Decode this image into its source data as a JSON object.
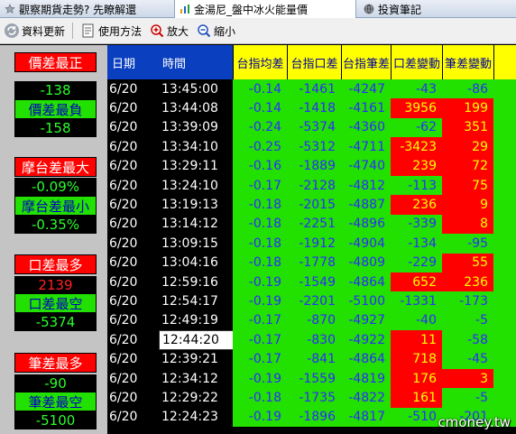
{
  "tabs": [
    {
      "icon": "star-icon",
      "label": "觀察期貨走勢? 先瞭解還"
    },
    {
      "icon": "chart-icon",
      "label": "金湯尼_盤中冰火能量價"
    },
    {
      "icon": "globe-icon",
      "label": "投資筆記"
    }
  ],
  "toolbar": {
    "refresh_label": "資料更新",
    "help_label": "使用方法",
    "zoom_in_label": "放大",
    "zoom_out_label": "縮小"
  },
  "left_panel": [
    {
      "label": "價差最正",
      "label_color": "red",
      "value": "-138",
      "value_color": "green"
    },
    {
      "label": "價差最負",
      "label_color": "green",
      "value": "-158",
      "value_color": "green"
    },
    {
      "label": "摩台差最大",
      "label_color": "red",
      "value": "-0.09%",
      "value_color": "green"
    },
    {
      "label": "摩台差最小",
      "label_color": "green",
      "value": "-0.35%",
      "value_color": "green"
    },
    {
      "label": "口差最多",
      "label_color": "red",
      "value": "2139",
      "value_color": "red"
    },
    {
      "label": "口差最空",
      "label_color": "green",
      "value": "-5374",
      "value_color": "green"
    },
    {
      "label": "筆差最多",
      "label_color": "red",
      "value": "-90",
      "value_color": "green"
    },
    {
      "label": "筆差最空",
      "label_color": "green",
      "value": "-5100",
      "value_color": "green"
    }
  ],
  "table": {
    "headers": {
      "date": "日期",
      "time": "時間",
      "avg_diff": "台指均差",
      "contract_diff": "台指口差",
      "trade_diff": "台指筆差",
      "contract_change": "口差變動",
      "trade_change": "筆差變動"
    },
    "rows": [
      {
        "date": "6/20",
        "time": "13:45:00",
        "avg": "-0.14",
        "cdiff": "-1461",
        "tdiff": "-4247",
        "cchg": "-43",
        "cchg_bg": "green",
        "tchg": "-86",
        "tchg_bg": "green",
        "selected": false
      },
      {
        "date": "6/20",
        "time": "13:44:08",
        "avg": "-0.14",
        "cdiff": "-1418",
        "tdiff": "-4161",
        "cchg": "3956",
        "cchg_bg": "red",
        "tchg": "199",
        "tchg_bg": "red",
        "selected": false
      },
      {
        "date": "6/20",
        "time": "13:39:09",
        "avg": "-0.24",
        "cdiff": "-5374",
        "tdiff": "-4360",
        "cchg": "-62",
        "cchg_bg": "green",
        "tchg": "351",
        "tchg_bg": "red",
        "selected": false
      },
      {
        "date": "6/20",
        "time": "13:34:10",
        "avg": "-0.25",
        "cdiff": "-5312",
        "tdiff": "-4711",
        "cchg": "-3423",
        "cchg_bg": "red",
        "tchg": "29",
        "tchg_bg": "red",
        "selected": false
      },
      {
        "date": "6/20",
        "time": "13:29:11",
        "avg": "-0.16",
        "cdiff": "-1889",
        "tdiff": "-4740",
        "cchg": "239",
        "cchg_bg": "red",
        "tchg": "72",
        "tchg_bg": "red",
        "selected": false
      },
      {
        "date": "6/20",
        "time": "13:24:10",
        "avg": "-0.17",
        "cdiff": "-2128",
        "tdiff": "-4812",
        "cchg": "-113",
        "cchg_bg": "green",
        "tchg": "75",
        "tchg_bg": "red",
        "selected": false
      },
      {
        "date": "6/20",
        "time": "13:19:13",
        "avg": "-0.18",
        "cdiff": "-2015",
        "tdiff": "-4887",
        "cchg": "236",
        "cchg_bg": "red",
        "tchg": "9",
        "tchg_bg": "red",
        "selected": false
      },
      {
        "date": "6/20",
        "time": "13:14:12",
        "avg": "-0.18",
        "cdiff": "-2251",
        "tdiff": "-4896",
        "cchg": "-339",
        "cchg_bg": "green",
        "tchg": "8",
        "tchg_bg": "red",
        "selected": false
      },
      {
        "date": "6/20",
        "time": "13:09:15",
        "avg": "-0.18",
        "cdiff": "-1912",
        "tdiff": "-4904",
        "cchg": "-134",
        "cchg_bg": "green",
        "tchg": "-95",
        "tchg_bg": "green",
        "selected": false
      },
      {
        "date": "6/20",
        "time": "13:04:16",
        "avg": "-0.18",
        "cdiff": "-1778",
        "tdiff": "-4809",
        "cchg": "-229",
        "cchg_bg": "green",
        "tchg": "55",
        "tchg_bg": "red",
        "selected": false
      },
      {
        "date": "6/20",
        "time": "12:59:16",
        "avg": "-0.19",
        "cdiff": "-1549",
        "tdiff": "-4864",
        "cchg": "652",
        "cchg_bg": "red",
        "tchg": "236",
        "tchg_bg": "red",
        "selected": false
      },
      {
        "date": "6/20",
        "time": "12:54:17",
        "avg": "-0.19",
        "cdiff": "-2201",
        "tdiff": "-5100",
        "cchg": "-1331",
        "cchg_bg": "green",
        "tchg": "-173",
        "tchg_bg": "green",
        "selected": false
      },
      {
        "date": "6/20",
        "time": "12:49:19",
        "avg": "-0.17",
        "cdiff": "-870",
        "tdiff": "-4927",
        "cchg": "-40",
        "cchg_bg": "green",
        "tchg": "-5",
        "tchg_bg": "green",
        "selected": false
      },
      {
        "date": "6/20",
        "time": "12:44:20",
        "avg": "-0.17",
        "cdiff": "-830",
        "tdiff": "-4922",
        "cchg": "11",
        "cchg_bg": "red",
        "tchg": "-58",
        "tchg_bg": "green",
        "selected": true
      },
      {
        "date": "6/20",
        "time": "12:39:21",
        "avg": "-0.17",
        "cdiff": "-841",
        "tdiff": "-4864",
        "cchg": "718",
        "cchg_bg": "red",
        "tchg": "-45",
        "tchg_bg": "green",
        "selected": false
      },
      {
        "date": "6/20",
        "time": "12:34:12",
        "avg": "-0.19",
        "cdiff": "-1559",
        "tdiff": "-4819",
        "cchg": "176",
        "cchg_bg": "red",
        "tchg": "3",
        "tchg_bg": "red",
        "selected": false
      },
      {
        "date": "6/20",
        "time": "12:29:22",
        "avg": "-0.18",
        "cdiff": "-1735",
        "tdiff": "-4822",
        "cchg": "161",
        "cchg_bg": "red",
        "tchg": "-5",
        "tchg_bg": "green",
        "selected": false
      },
      {
        "date": "6/20",
        "time": "12:24:23",
        "avg": "-0.19",
        "cdiff": "-1896",
        "tdiff": "-4817",
        "cchg": "-510",
        "cchg_bg": "green",
        "tchg": "-201",
        "tchg_bg": "green",
        "selected": false
      }
    ]
  },
  "watermark": "cmoney.tw",
  "colors": {
    "red": "#ff0000",
    "green": "#22e000",
    "yellow": "#ffff00",
    "header_blue": "#0a3fc0",
    "value_blue": "#2d2dff"
  }
}
